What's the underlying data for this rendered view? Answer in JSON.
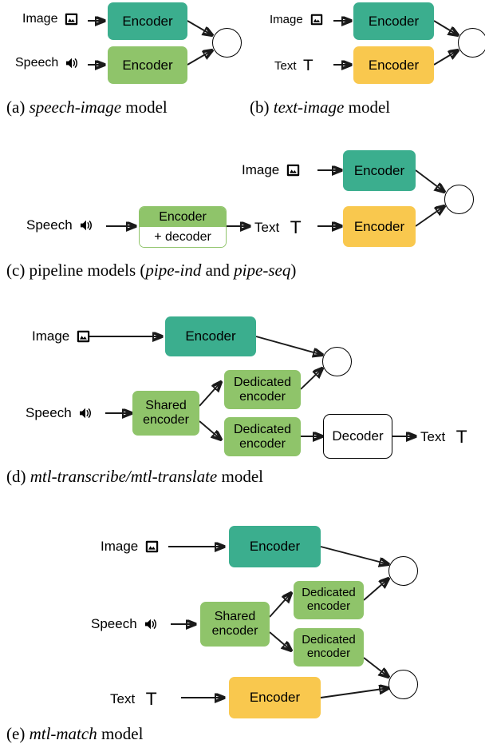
{
  "figure": {
    "panels": [
      {
        "id": "a",
        "caption_prefix": "(a) ",
        "caption_italic": "speech-image",
        "caption_suffix": " model",
        "inputs": [
          {
            "label": "Image",
            "icon": "image-icon"
          },
          {
            "label": "Speech",
            "icon": "speaker-icon"
          }
        ],
        "blocks": [
          {
            "label": "Encoder",
            "color": "#3bae8e"
          },
          {
            "label": "Encoder",
            "color": "#8fc46a"
          }
        ],
        "output_nodes": 1
      },
      {
        "id": "b",
        "caption_prefix": "(b) ",
        "caption_italic": "text-image",
        "caption_suffix": " model",
        "inputs": [
          {
            "label": "Image",
            "icon": "image-icon"
          },
          {
            "label": "Text",
            "icon": "text-icon"
          }
        ],
        "blocks": [
          {
            "label": "Encoder",
            "color": "#3bae8e"
          },
          {
            "label": "Encoder",
            "color": "#f9c84e"
          }
        ],
        "output_nodes": 1
      },
      {
        "id": "c",
        "caption_prefix": "(c) pipeline models (",
        "caption_italic": "pipe-ind",
        "caption_mid": " and ",
        "caption_italic2": "pipe-seq",
        "caption_suffix": ")",
        "inputs": [
          {
            "label": "Speech",
            "icon": "speaker-icon"
          },
          {
            "label": "Image",
            "icon": "image-icon"
          },
          {
            "label": "Text",
            "icon": "text-icon"
          }
        ],
        "blocks": [
          {
            "label_top": "Encoder",
            "label_bottom": "+ decoder",
            "color": "#8fc46a"
          },
          {
            "label": "Encoder",
            "color": "#3bae8e"
          },
          {
            "label": "Encoder",
            "color": "#f9c84e"
          }
        ],
        "output_nodes": 1
      },
      {
        "id": "d",
        "caption_prefix": "(d) ",
        "caption_italic": "mtl-transcribe/mtl-translate",
        "caption_suffix": " model",
        "inputs": [
          {
            "label": "Image",
            "icon": "image-icon"
          },
          {
            "label": "Speech",
            "icon": "speaker-icon"
          }
        ],
        "outputs": [
          {
            "label": "Text",
            "icon": "text-icon"
          }
        ],
        "blocks": [
          {
            "label": "Encoder",
            "color": "#3bae8e"
          },
          {
            "label": "Shared\nencoder",
            "color": "#8fc46a"
          },
          {
            "label": "Dedicated\nencoder",
            "color": "#8fc46a"
          },
          {
            "label": "Dedicated\nencoder",
            "color": "#8fc46a"
          },
          {
            "label": "Decoder",
            "color": "#ffffff"
          }
        ],
        "output_nodes": 1
      },
      {
        "id": "e",
        "caption_prefix": "(e) ",
        "caption_italic": "mtl-match",
        "caption_suffix": " model",
        "inputs": [
          {
            "label": "Image",
            "icon": "image-icon"
          },
          {
            "label": "Speech",
            "icon": "speaker-icon"
          },
          {
            "label": "Text",
            "icon": "text-icon"
          }
        ],
        "blocks": [
          {
            "label": "Encoder",
            "color": "#3bae8e"
          },
          {
            "label": "Shared\nencoder",
            "color": "#8fc46a"
          },
          {
            "label": "Dedicated\nencoder",
            "color": "#8fc46a"
          },
          {
            "label": "Dedicated\nencoder",
            "color": "#8fc46a"
          },
          {
            "label": "Encoder",
            "color": "#f9c84e"
          }
        ],
        "output_nodes": 2
      }
    ]
  },
  "labels": {
    "image": "Image",
    "speech": "Speech",
    "text": "Text",
    "encoder": "Encoder",
    "decoder": "Decoder",
    "encoder_top": "Encoder",
    "decoder_bottom": "+ decoder",
    "shared_encoder": "Shared\nencoder",
    "dedicated_encoder": "Dedicated\nencoder"
  },
  "captions": {
    "a_prefix": "(a) ",
    "a_italic": "speech-image",
    "a_suffix": " model",
    "b_prefix": "(b) ",
    "b_italic": "text-image",
    "b_suffix": " model",
    "c_prefix": "(c) pipeline models (",
    "c_italic": "pipe-ind",
    "c_mid": " and ",
    "c_italic2": "pipe-seq",
    "c_suffix": ")",
    "d_prefix": "(d) ",
    "d_italic": "mtl-transcribe/mtl-translate",
    "d_suffix": " model",
    "e_prefix": "(e) ",
    "e_italic": "mtl-match",
    "e_suffix": " model"
  },
  "colors": {
    "teal": "#3bae8e",
    "green": "#8fc46a",
    "yellow": "#f9c84e",
    "stroke": "#1a1a1a",
    "white": "#ffffff"
  },
  "icons": {
    "image": "image-icon",
    "speaker": "speaker-icon",
    "text": "T"
  }
}
